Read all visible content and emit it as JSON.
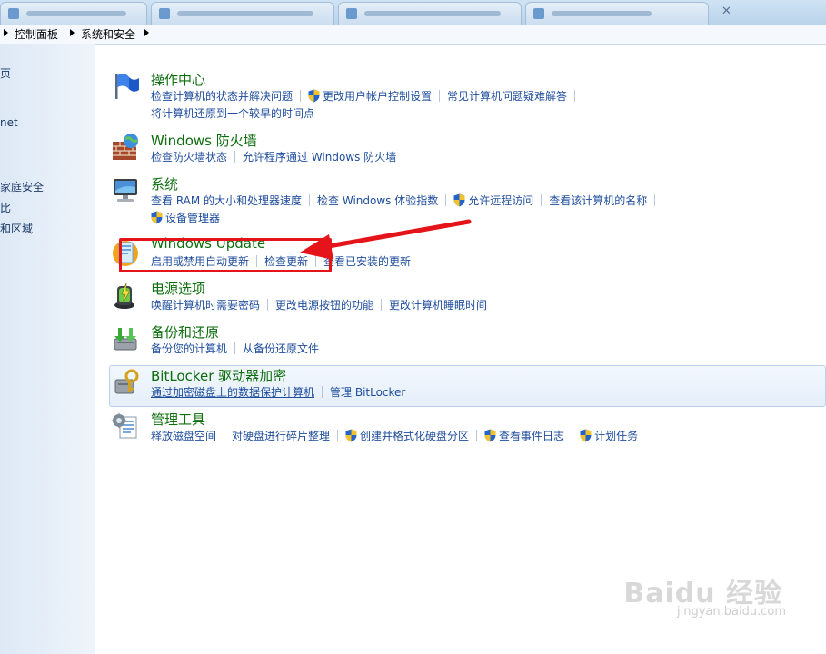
{
  "breadcrumb": {
    "items": [
      "控制面板",
      "系统和安全"
    ]
  },
  "tabbar": {
    "close_glyph": "✕"
  },
  "sidebar": {
    "items": [
      "页",
      "net",
      "家庭安全",
      "比",
      "和区域"
    ]
  },
  "categories": [
    {
      "title": "操作中心",
      "icon": "flag-icon",
      "rows": [
        [
          {
            "text": "检查计算机的状态并解决问题",
            "shield": false
          },
          {
            "text": "更改用户帐户控制设置",
            "shield": true
          },
          {
            "text": "常见计算机问题疑难解答",
            "shield": false
          }
        ],
        [
          {
            "text": "将计算机还原到一个较早的时间点",
            "shield": false
          }
        ]
      ]
    },
    {
      "title": "Windows 防火墙",
      "icon": "firewall-icon",
      "rows": [
        [
          {
            "text": "检查防火墙状态",
            "shield": false
          },
          {
            "text": "允许程序通过 Windows 防火墙",
            "shield": false
          }
        ]
      ]
    },
    {
      "title": "系统",
      "icon": "computer-icon",
      "rows": [
        [
          {
            "text": "查看 RAM 的大小和处理器速度",
            "shield": false
          },
          {
            "text": "检查 Windows 体验指数",
            "shield": false
          },
          {
            "text": "允许远程访问",
            "shield": true
          },
          {
            "text": "查看该计算机的名称",
            "shield": false
          }
        ],
        [
          {
            "text": "设备管理器",
            "shield": true
          }
        ]
      ]
    },
    {
      "title": "Windows Update",
      "icon": "windows-update-icon",
      "rows": [
        [
          {
            "text": "启用或禁用自动更新",
            "shield": false
          },
          {
            "text": "检查更新",
            "shield": false
          },
          {
            "text": "查看已安装的更新",
            "shield": false
          }
        ]
      ]
    },
    {
      "title": "电源选项",
      "icon": "power-options-icon",
      "rows": [
        [
          {
            "text": "唤醒计算机时需要密码",
            "shield": false
          },
          {
            "text": "更改电源按钮的功能",
            "shield": false
          },
          {
            "text": "更改计算机睡眠时间",
            "shield": false
          }
        ]
      ]
    },
    {
      "title": "备份和还原",
      "icon": "backup-restore-icon",
      "rows": [
        [
          {
            "text": "备份您的计算机",
            "shield": false
          },
          {
            "text": "从备份还原文件",
            "shield": false
          }
        ]
      ]
    },
    {
      "title": "BitLocker 驱动器加密",
      "icon": "bitlocker-icon",
      "rows": [
        [
          {
            "text": "通过加密磁盘上的数据保护计算机",
            "shield": false
          },
          {
            "text": "管理 BitLocker",
            "shield": false
          }
        ]
      ]
    },
    {
      "title": "管理工具",
      "icon": "admin-tools-icon",
      "rows": [
        [
          {
            "text": "释放磁盘空间",
            "shield": false
          },
          {
            "text": "对硬盘进行碎片整理",
            "shield": false
          },
          {
            "text": "创建并格式化硬盘分区",
            "shield": true
          },
          {
            "text": "查看事件日志",
            "shield": true
          },
          {
            "text": "计划任务",
            "shield": true
          }
        ]
      ]
    }
  ],
  "watermark": {
    "brand": "Baidu 经验",
    "url": "jingyan.baidu.com"
  },
  "colors": {
    "title_green": "#0c6e0c",
    "link_blue": "#1f4d9c",
    "annotation_red": "#e5141a"
  }
}
